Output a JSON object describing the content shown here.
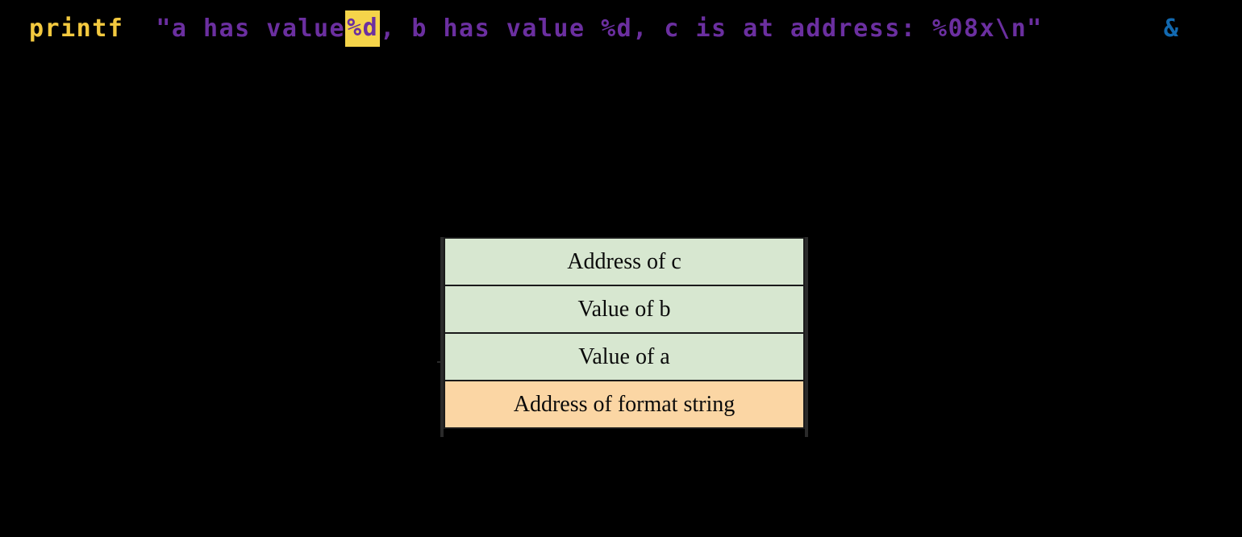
{
  "code_line": {
    "function_name": "printf",
    "string_part_1": "\"a has value ",
    "highlighted_format": "%d",
    "string_part_2": ", b has value %d, c is at address: %08x\\n\"",
    "ampersand": "&",
    "colors": {
      "function": "#f3c93f",
      "string": "#6b2fa0",
      "highlight_bg": "#f5d44a",
      "ampersand": "#1269b0",
      "background": "#000000"
    }
  },
  "stack_diagram": {
    "rows": [
      {
        "label": "Address of c",
        "kind": "value",
        "color": "#d7e7d0"
      },
      {
        "label": "Value of b",
        "kind": "value",
        "color": "#d7e7d0"
      },
      {
        "label": "Value of a",
        "kind": "value",
        "color": "#d7e7d0"
      },
      {
        "label": "Address of format string",
        "kind": "format",
        "color": "#fbd6a4"
      }
    ],
    "border_color": "#1a1a1a"
  }
}
